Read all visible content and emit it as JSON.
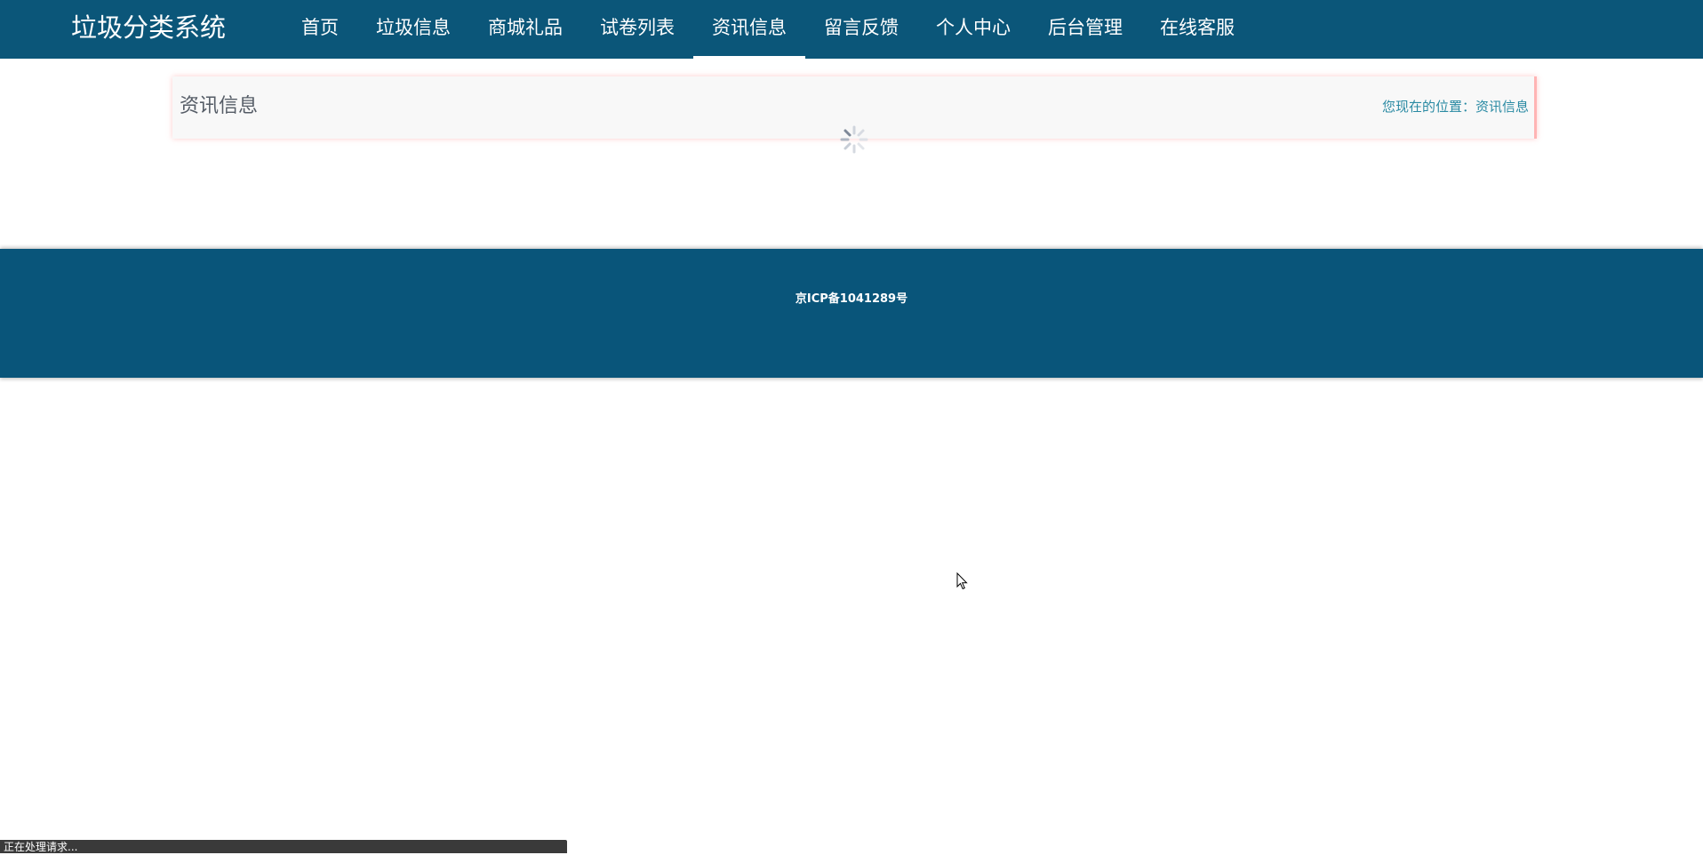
{
  "header": {
    "site_title": "垃圾分类系统",
    "nav": [
      {
        "label": "首页"
      },
      {
        "label": "垃圾信息"
      },
      {
        "label": "商城礼品"
      },
      {
        "label": "试卷列表"
      },
      {
        "label": "资讯信息",
        "active": true
      },
      {
        "label": "留言反馈"
      },
      {
        "label": "个人中心"
      },
      {
        "label": "后台管理"
      },
      {
        "label": "在线客服"
      }
    ]
  },
  "main": {
    "page_title": "资讯信息",
    "breadcrumb": "您现在的位置：资讯信息"
  },
  "footer": {
    "icp": "京ICP备1041289号"
  },
  "status": {
    "text": "正在处理请求..."
  },
  "icons": {
    "loading": "loading-spinner-icon",
    "cursor": "mouse-cursor-icon"
  },
  "colors": {
    "brand": "#0b5679",
    "footer": "#09557a",
    "breadcrumb": "#2a8aa3"
  }
}
